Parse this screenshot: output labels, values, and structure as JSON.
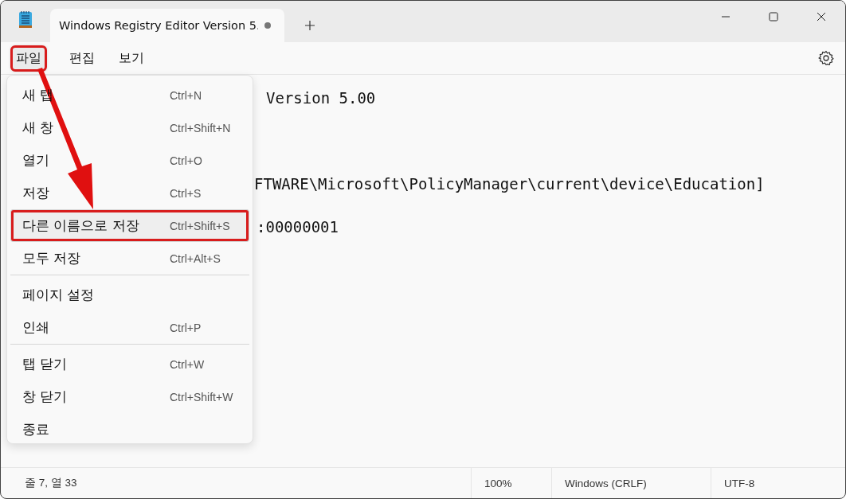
{
  "tab": {
    "title": "Windows Registry Editor Version 5.",
    "modified": true,
    "selected": true
  },
  "menubar": [
    {
      "label": "파일",
      "selected": true,
      "highlighted": true
    },
    {
      "label": "편집",
      "selected": false,
      "highlighted": false
    },
    {
      "label": "보기",
      "selected": false,
      "highlighted": false
    }
  ],
  "editor_lines": [
    {
      "text": "Version 5.00"
    },
    {
      "text": "FTWARE\\Microsoft\\PolicyManager\\current\\device\\Education]"
    },
    {
      "text": ":00000001"
    }
  ],
  "file_menu": [
    {
      "label": "새 탭",
      "shortcut": "Ctrl+N",
      "highlighted": false,
      "separator_before": false
    },
    {
      "label": "새 창",
      "shortcut": "Ctrl+Shift+N",
      "highlighted": false,
      "separator_before": false
    },
    {
      "label": "열기",
      "shortcut": "Ctrl+O",
      "highlighted": false,
      "separator_before": false
    },
    {
      "label": "저장",
      "shortcut": "Ctrl+S",
      "highlighted": false,
      "separator_before": false
    },
    {
      "label": "다른 이름으로 저장",
      "shortcut": "Ctrl+Shift+S",
      "highlighted": true,
      "separator_before": false
    },
    {
      "label": "모두 저장",
      "shortcut": "Ctrl+Alt+S",
      "highlighted": false,
      "separator_before": false
    },
    {
      "label": "페이지 설정",
      "highlighted": false,
      "separator_before": true
    },
    {
      "label": "인쇄",
      "shortcut": "Ctrl+P",
      "highlighted": false,
      "separator_before": false
    },
    {
      "label": "탭 닫기",
      "shortcut": "Ctrl+W",
      "highlighted": false,
      "separator_before": true
    },
    {
      "label": "창 닫기",
      "shortcut": "Ctrl+Shift+W",
      "highlighted": false,
      "separator_before": false
    },
    {
      "label": "종료",
      "highlighted": false,
      "separator_before": false
    }
  ],
  "status_bar": {
    "position": "줄 7, 열 33",
    "zoom": "100%",
    "line_ending": "Windows (CRLF)",
    "encoding": "UTF-8"
  }
}
